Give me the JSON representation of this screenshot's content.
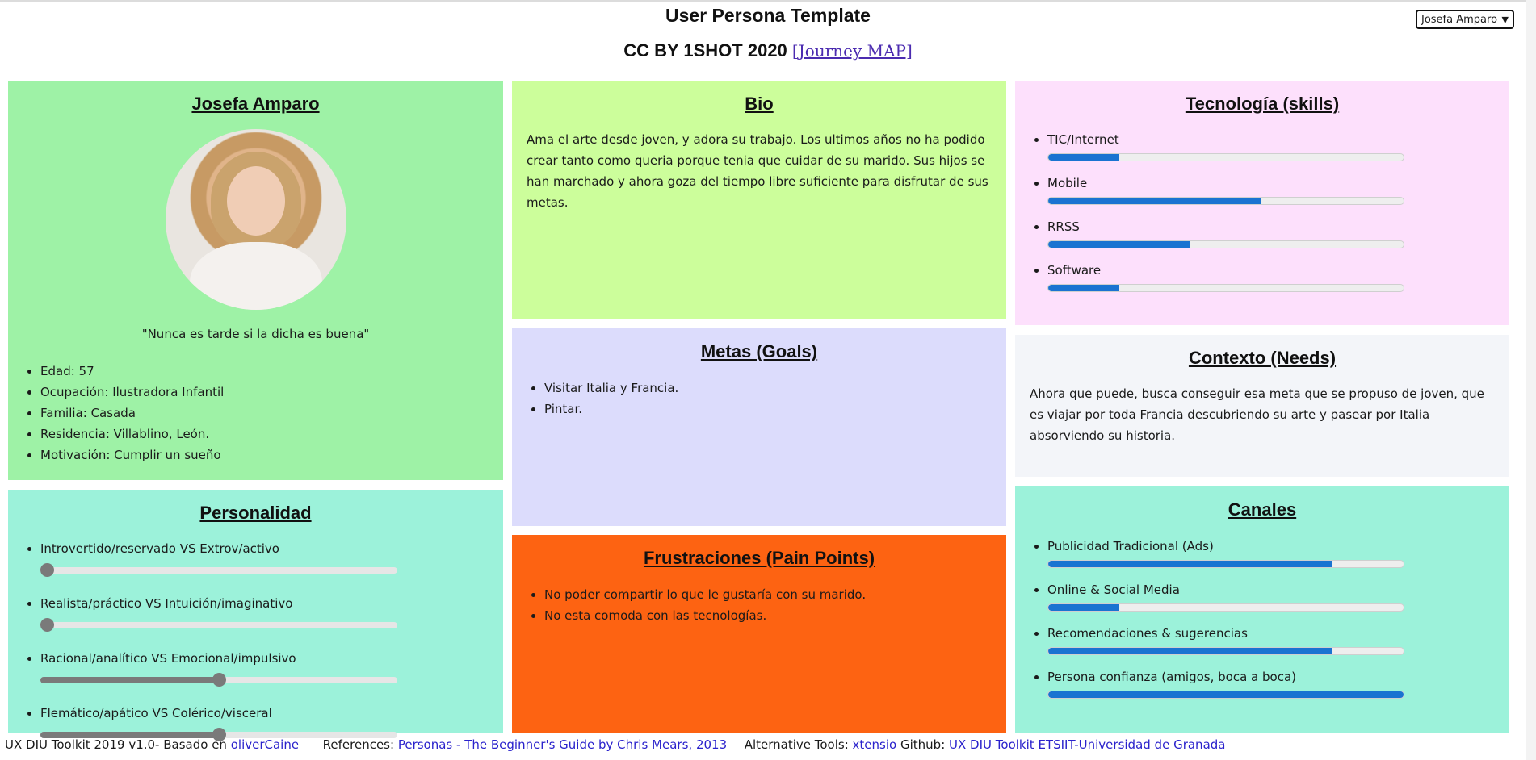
{
  "header": {
    "title": "User Persona Template",
    "subtitle": "CC BY 1SHOT 2020",
    "journey_link": "[Journey MAP]",
    "persona_select": "Josefa Amparo"
  },
  "profile": {
    "name": "Josefa Amparo",
    "quote": "\"Nunca es tarde si la dicha es buena\"",
    "facts": [
      "Edad: 57",
      "Ocupación: Ilustradora Infantil",
      "Familia: Casada",
      "Residencia: Villablino, León.",
      "Motivación: Cumplir un sueño"
    ],
    "color": "#9ef2a6"
  },
  "bio": {
    "title": "Bio",
    "text": "Ama el arte desde joven, y adora su trabajo. Los ultimos años no ha podido crear tanto como queria porque tenia que cuidar de su marido. Sus hijos se han marchado y ahora goza del tiempo libre suficiente para disfrutar de sus metas.",
    "color": "#ccfe9b"
  },
  "goals": {
    "title": "Metas (Goals)",
    "items": [
      "Visitar Italia y Francia.",
      "Pintar."
    ],
    "color": "#dcdcfc"
  },
  "frustrations": {
    "title": "Frustraciones (Pain Points)",
    "items": [
      "No poder compartir lo que le gustaría con su marido.",
      "No esta comoda con las tecnologías."
    ],
    "color": "#fd6312"
  },
  "personality": {
    "title": "Personalidad",
    "items": [
      {
        "label": "Introvertido/reservado VS Extrov/activo",
        "value": 0
      },
      {
        "label": "Realista/práctico VS Intuición/imaginativo",
        "value": 0
      },
      {
        "label": "Racional/analítico VS Emocional/impulsivo",
        "value": 50
      },
      {
        "label": "Flemático/apático VS Colérico/visceral",
        "value": 50
      }
    ],
    "color": "#9cf2da"
  },
  "technology": {
    "title": "Tecnología (skills)",
    "items": [
      {
        "label": "TIC/Internet",
        "value": 20
      },
      {
        "label": "Mobile",
        "value": 60
      },
      {
        "label": "RRSS",
        "value": 40
      },
      {
        "label": "Software",
        "value": 20
      }
    ],
    "color": "#fde0fc"
  },
  "context": {
    "title": "Contexto (Needs)",
    "text": "Ahora que puede, busca conseguir esa meta que se propuso de joven, que es viajar por toda Francia descubriendo su arte y pasear por Italia absorviendo su historia.",
    "color": "#f3f5f9"
  },
  "channels": {
    "title": "Canales",
    "items": [
      {
        "label": "Publicidad Tradicional (Ads)",
        "value": 80
      },
      {
        "label": "Online & Social Media",
        "value": 20
      },
      {
        "label": "Recomendaciones & sugerencias",
        "value": 80
      },
      {
        "label": "Persona confianza (amigos, boca a boca)",
        "value": 100
      }
    ],
    "color": "#9cf2da"
  },
  "footer": {
    "prefix": "UX DIU Toolkit 2019 v1.0- Basado en",
    "based_link": "oliverCaine",
    "references_label": "References:",
    "references_link": "Personas - The Beginner's Guide by Chris Mears, 2013",
    "alt_label": "Alternative Tools:",
    "alt_link": "xtensio",
    "github_label": "Github:",
    "github_link": "UX DIU Toolkit",
    "univ_link": "ETSIIT-Universidad de Granada"
  }
}
